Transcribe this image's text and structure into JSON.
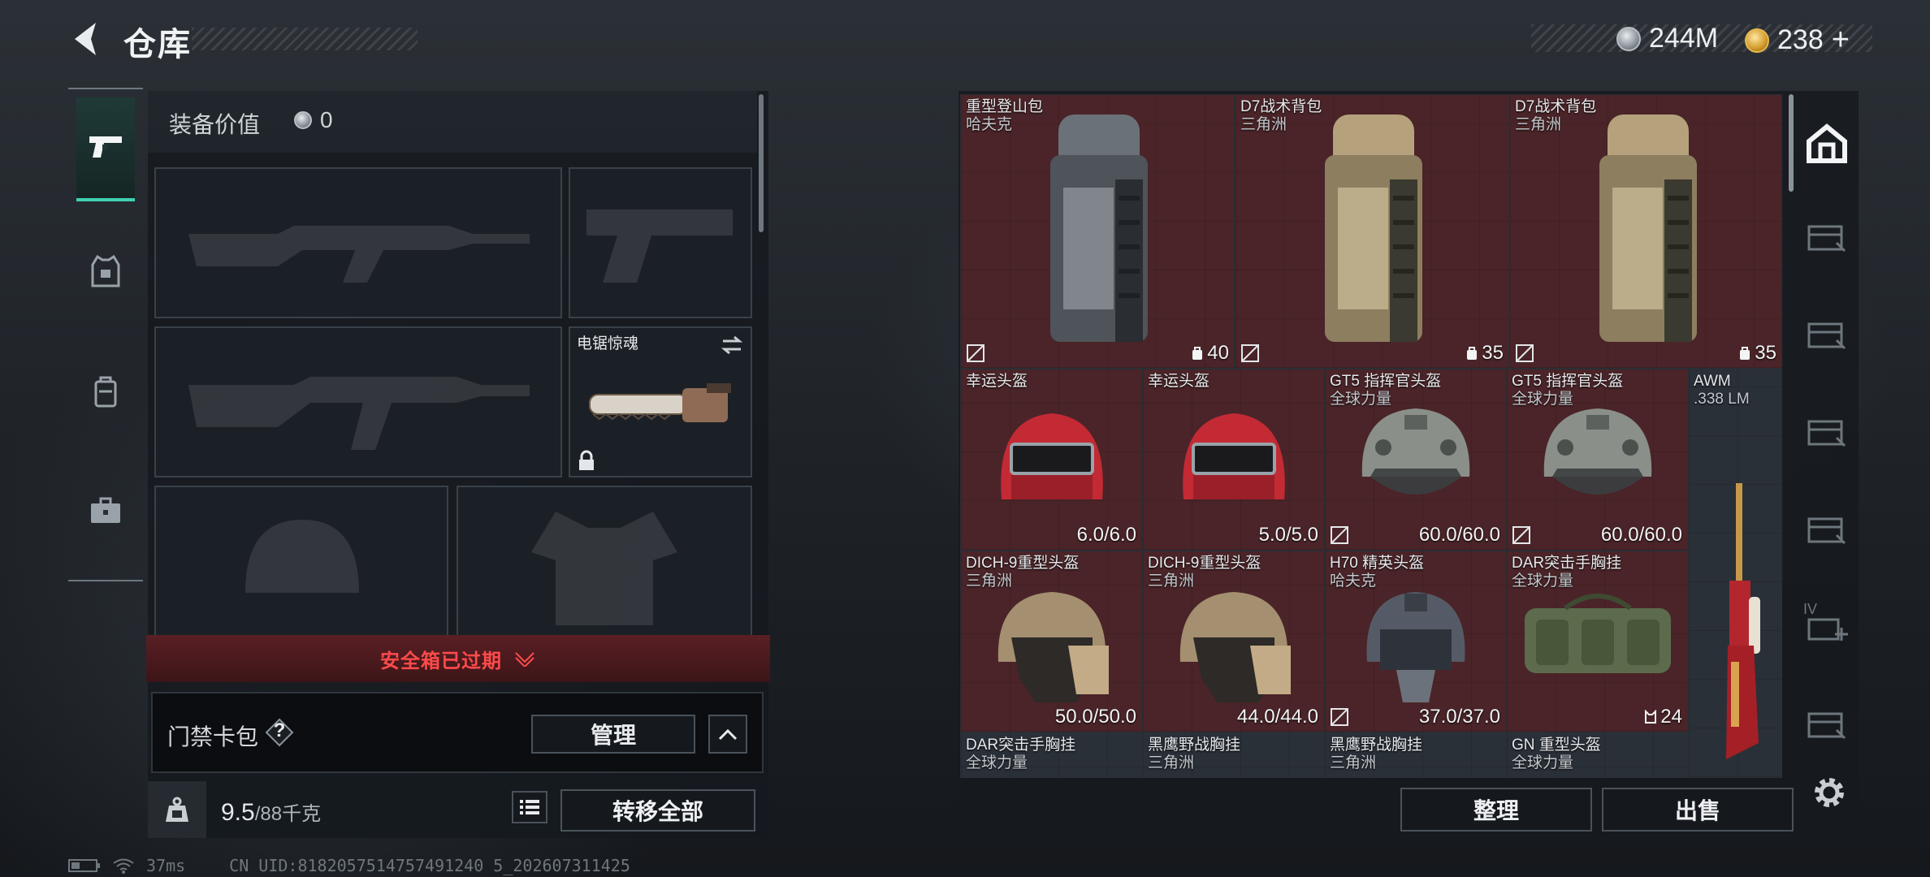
{
  "header": {
    "title": "仓库"
  },
  "currencies": [
    {
      "icon": "silver-coin-icon",
      "value": "244M"
    },
    {
      "icon": "gold-coin-icon",
      "value": "238"
    }
  ],
  "currency_plus": "+",
  "nav": [
    {
      "name": "weapon-tab",
      "icon": "pistol-icon",
      "active": true
    },
    {
      "name": "armor-tab",
      "icon": "vest-icon",
      "active": false
    },
    {
      "name": "backpack-tab",
      "icon": "backpack-icon",
      "active": false
    },
    {
      "name": "case-tab",
      "icon": "briefcase-icon",
      "active": false
    }
  ],
  "equipment": {
    "value_label": "装备价值",
    "value": "0",
    "melee_name": "电锯惊魂",
    "safebox_status": "安全箱已过期",
    "card_pack_label": "门禁卡包",
    "help": "?",
    "manage_label": "管理",
    "weight_value": "9.5",
    "weight_max": "/88千克",
    "transfer_all_label": "转移全部"
  },
  "storage": {
    "items": [
      {
        "name": "重型登山包",
        "maker": "哈夫克",
        "stat": "40",
        "kind": "backpack",
        "color": "grey"
      },
      {
        "name": "D7战术背包",
        "maker": "三角洲",
        "stat": "35",
        "kind": "backpack",
        "color": "tan"
      },
      {
        "name": "D7战术背包",
        "maker": "三角洲",
        "stat": "35",
        "kind": "backpack",
        "color": "tan"
      },
      {
        "name": "幸运头盔",
        "maker": "",
        "stat": "6.0/6.0",
        "kind": "helmet-red"
      },
      {
        "name": "幸运头盔",
        "maker": "",
        "stat": "5.0/5.0",
        "kind": "helmet-red"
      },
      {
        "name": "GT5 指挥官头盔",
        "maker": "全球力量",
        "stat": "60.0/60.0",
        "kind": "helmet-grey"
      },
      {
        "name": "GT5 指挥官头盔",
        "maker": "全球力量",
        "stat": "60.0/60.0",
        "kind": "helmet-grey"
      },
      {
        "name": "AWM",
        "maker": ".338 LM",
        "stat": "",
        "kind": "rifle"
      },
      {
        "name": "DICH-9重型头盔",
        "maker": "三角洲",
        "stat": "50.0/50.0",
        "kind": "helmet-tan"
      },
      {
        "name": "DICH-9重型头盔",
        "maker": "三角洲",
        "stat": "44.0/44.0",
        "kind": "helmet-tan"
      },
      {
        "name": "H70 精英头盔",
        "maker": "哈夫克",
        "stat": "37.0/37.0",
        "kind": "helmet-dark"
      },
      {
        "name": "DAR突击手胸挂",
        "maker": "全球力量",
        "stat": "24",
        "kind": "rig"
      },
      {
        "name": "DAR突击手胸挂",
        "maker": "全球力量",
        "stat": "",
        "kind": "partial"
      },
      {
        "name": "黑鹰野战胸挂",
        "maker": "三角洲",
        "stat": "",
        "kind": "partial"
      },
      {
        "name": "黑鹰野战胸挂",
        "maker": "三角洲",
        "stat": "",
        "kind": "partial"
      },
      {
        "name": "GN 重型头盔",
        "maker": "全球力量",
        "stat": "",
        "kind": "partial"
      }
    ],
    "side_tabs": [
      {
        "icon": "home-storage-icon",
        "label": ""
      },
      {
        "icon": "storage-tab-icon",
        "label": ""
      },
      {
        "icon": "storage-tab-icon",
        "label": ""
      },
      {
        "icon": "storage-tab-icon",
        "label": ""
      },
      {
        "icon": "storage-tab-icon",
        "label": ""
      },
      {
        "icon": "storage-tab-icon",
        "label": "IV"
      },
      {
        "icon": "storage-tab-icon",
        "label": ""
      }
    ],
    "sort_label": "整理",
    "sell_label": "出售"
  },
  "status_bar": {
    "ping": "37ms",
    "uid": "CN UID:8182057514757491240 5_202607311425"
  }
}
